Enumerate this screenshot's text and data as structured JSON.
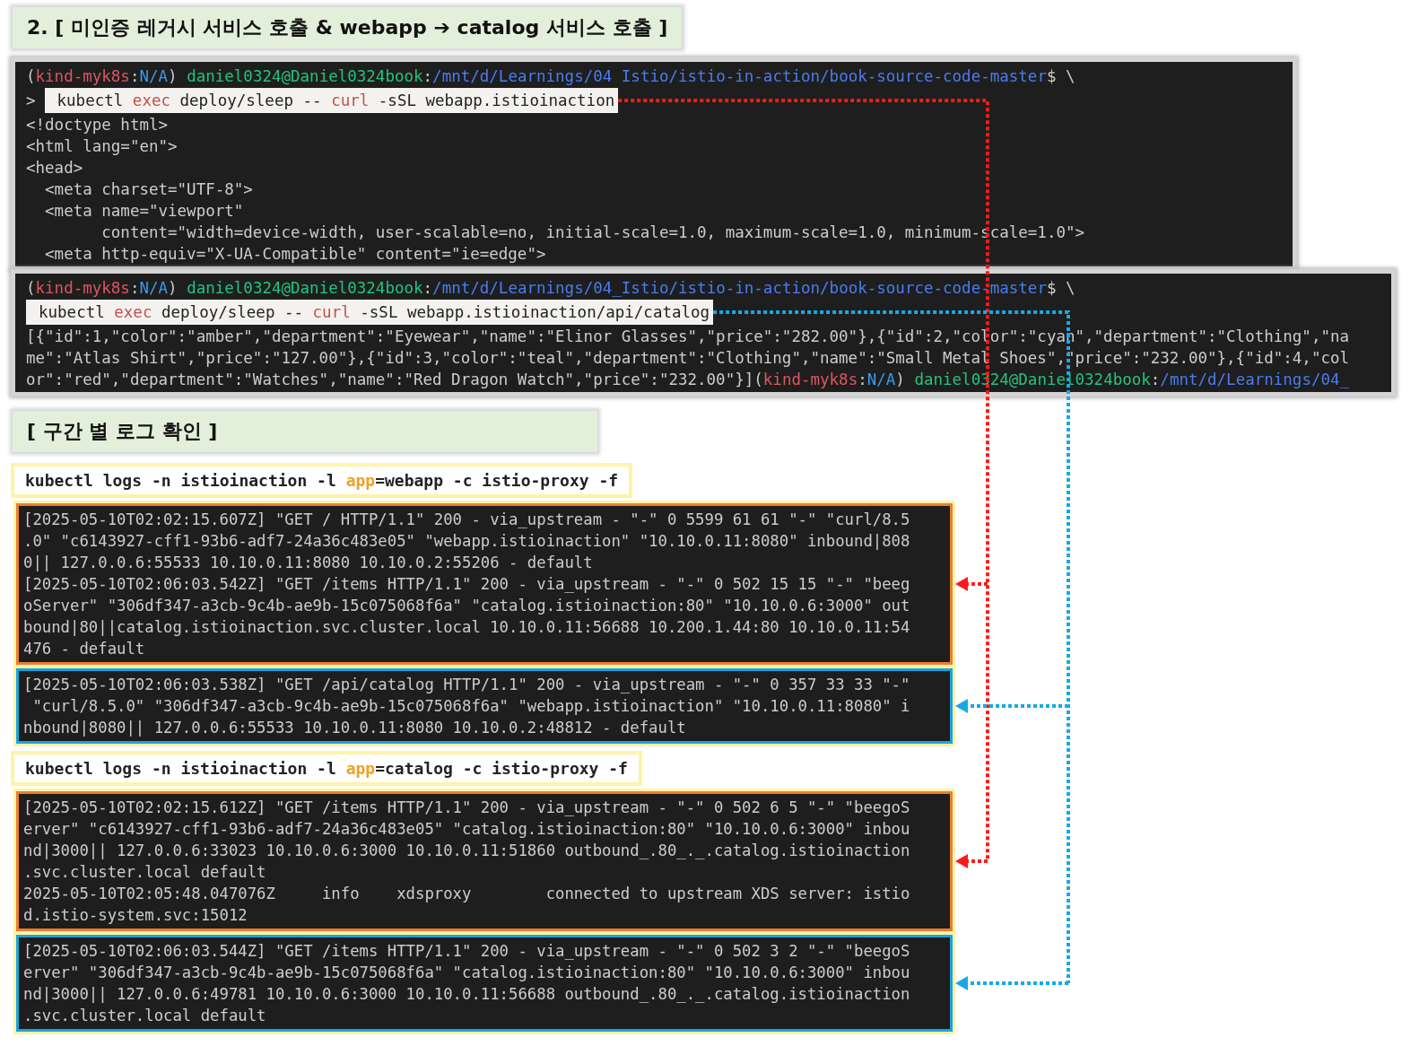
{
  "title": "2. [ 미인증 레거시 서비스 호출 & webapp ➔ catalog 서비스 호출 ]",
  "terminals": [
    {
      "prompt": [
        {
          "text": "(",
          "color": "#cccccc"
        },
        {
          "text": "kind-myk8s",
          "color": "#e05561"
        },
        {
          "text": ":",
          "color": "#cccccc"
        },
        {
          "text": "N/A",
          "color": "#3b9ae8"
        },
        {
          "text": ")",
          "color": "#cccccc"
        },
        {
          "text": " daniel0324@Daniel0324book",
          "color": "#23c47e"
        },
        {
          "text": ":",
          "color": "#cccccc"
        },
        {
          "text": "/mnt/d/Learnings/04 Istio/istio-in-action/book-source-code-master",
          "color": "#4a7cf0"
        },
        {
          "text": "$ \\",
          "color": "#cccccc"
        }
      ],
      "caret": ">",
      "command": [
        {
          "text": "kubectl ",
          "color": "#222222"
        },
        {
          "text": "exec",
          "color": "#c0504d"
        },
        {
          "text": " deploy/sleep -- ",
          "color": "#222222"
        },
        {
          "text": "curl",
          "color": "#c0504d"
        },
        {
          "text": " -sSL webapp.istioinaction",
          "color": "#222222"
        }
      ],
      "output": [
        [
          {
            "text": "<!doctype html>"
          }
        ],
        [
          {
            "text": "<html lang=\"en\">"
          }
        ],
        [
          {
            "text": "<head>"
          }
        ],
        [
          {
            "text": "  <meta charset=\"UTF-8\">"
          }
        ],
        [
          {
            "text": "  <meta name=\"viewport\""
          }
        ],
        [
          {
            "text": "        content=\"width=device-width, user-scalable=no, initial-scale=1.0, maximum-scale=1.0, minimum-scale=1.0\">"
          }
        ],
        [
          {
            "text": "  <meta http-equiv=\"X-UA-Compatible\" content=\"ie=edge\">"
          }
        ]
      ]
    },
    {
      "prompt": [
        {
          "text": "(",
          "color": "#cccccc"
        },
        {
          "text": "kind-myk8s",
          "color": "#e05561"
        },
        {
          "text": ":",
          "color": "#cccccc"
        },
        {
          "text": "N/A",
          "color": "#3b9ae8"
        },
        {
          "text": ")",
          "color": "#cccccc"
        },
        {
          "text": " daniel0324@Daniel0324book",
          "color": "#23c47e"
        },
        {
          "text": ":",
          "color": "#cccccc"
        },
        {
          "text": "/mnt/d/Learnings/04_Istio/istio-in-action/book-source-code-master",
          "color": "#4a7cf0"
        },
        {
          "text": "$ \\",
          "color": "#cccccc"
        }
      ],
      "command": [
        {
          "text": "kubectl ",
          "color": "#222222"
        },
        {
          "text": "exec",
          "color": "#c0504d"
        },
        {
          "text": " deploy/sleep -- ",
          "color": "#222222"
        },
        {
          "text": "curl",
          "color": "#c0504d"
        },
        {
          "text": " -sSL webapp.istioinaction/api/catalog",
          "color": "#222222"
        }
      ],
      "output": [
        [
          {
            "text": "[{\"id\":1,\"color\":\"amber\",\"department\":\"Eyewear\",\"name\":\"Elinor Glasses\",\"price\":\"282.00\"},{\"id\":2,\"color\":\"cyan\",\"department\":\"Clothing\",\"na"
          }
        ],
        [
          {
            "text": "me\":\"Atlas Shirt\",\"price\":\"127.00\"},{\"id\":3,\"color\":\"teal\",\"department\":\"Clothing\",\"name\":\"Small Metal Shoes\",\"price\":\"232.00\"},{\"id\":4,\"col"
          }
        ],
        [
          {
            "text": "or\":\"red\",\"department\":\"Watches\",\"name\":\"Red Dragon Watch\",\"price\":\"232.00\"}]"
          },
          {
            "text": "(",
            "color": "#cccccc"
          },
          {
            "text": "kind-myk8s",
            "color": "#e05561"
          },
          {
            "text": ":",
            "color": "#cccccc"
          },
          {
            "text": "N/A",
            "color": "#3b9ae8"
          },
          {
            "text": ")",
            "color": "#cccccc"
          },
          {
            "text": " daniel0324@Daniel0324book",
            "color": "#23c47e"
          },
          {
            "text": ":",
            "color": "#cccccc"
          },
          {
            "text": "/mnt/d/Learnings/04_",
            "color": "#4a7cf0"
          }
        ]
      ]
    }
  ],
  "section_title": "[ 구간 별 로그 확인 ]",
  "log_sections": [
    {
      "command": [
        {
          "text": "kubectl logs -n istioinaction -l ",
          "color": "#222222"
        },
        {
          "text": "app",
          "color": "#f0a020"
        },
        {
          "text": "=webapp -c istio-proxy -f",
          "color": "#222222"
        }
      ],
      "boxes": [
        {
          "color": "#ed7d31",
          "lines": [
            "[2025-05-10T02:02:15.607Z] \"GET / HTTP/1.1\" 200 - via_upstream - \"-\" 0 5599 61 61 \"-\" \"curl/8.5",
            ".0\" \"c6143927-cff1-93b6-adf7-24a36c483e05\" \"webapp.istioinaction\" \"10.10.0.11:8080\" inbound|808",
            "0|| 127.0.0.6:55533 10.10.0.11:8080 10.10.0.2:55206 - default",
            "[2025-05-10T02:06:03.542Z] \"GET /items HTTP/1.1\" 200 - via_upstream - \"-\" 0 502 15 15 \"-\" \"beeg",
            "oServer\" \"306df347-a3cb-9c4b-ae9b-15c075068f6a\" \"catalog.istioinaction:80\" \"10.10.0.6:3000\" out",
            "bound|80||catalog.istioinaction.svc.cluster.local 10.10.0.11:56688 10.200.1.44:80 10.10.0.11:54",
            "476 - default"
          ]
        },
        {
          "color": "#1aa3e0",
          "lines": [
            "[2025-05-10T02:06:03.538Z] \"GET /api/catalog HTTP/1.1\" 200 - via_upstream - \"-\" 0 357 33 33 \"-\"",
            " \"curl/8.5.0\" \"306df347-a3cb-9c4b-ae9b-15c075068f6a\" \"webapp.istioinaction\" \"10.10.0.11:8080\" i",
            "nbound|8080|| 127.0.0.6:55533 10.10.0.11:8080 10.10.0.2:48812 - default"
          ]
        }
      ]
    },
    {
      "command": [
        {
          "text": "kubectl logs -n istioinaction -l ",
          "color": "#222222"
        },
        {
          "text": "app",
          "color": "#f0a020"
        },
        {
          "text": "=catalog -c istio-proxy -f",
          "color": "#222222"
        }
      ],
      "boxes": [
        {
          "color": "#ed7d31",
          "lines": [
            "[2025-05-10T02:02:15.612Z] \"GET /items HTTP/1.1\" 200 - via_upstream - \"-\" 0 502 6 5 \"-\" \"beegoS",
            "erver\" \"c6143927-cff1-93b6-adf7-24a36c483e05\" \"catalog.istioinaction:80\" \"10.10.0.6:3000\" inbou",
            "nd|3000|| 127.0.0.6:33023 10.10.0.6:3000 10.10.0.11:51860 outbound_.80_._.catalog.istioinaction",
            ".svc.cluster.local default",
            "2025-05-10T02:05:48.047076Z     info    xdsproxy        connected to upstream XDS server: istio",
            "d.istio-system.svc:15012"
          ]
        },
        {
          "color": "#1aa3e0",
          "lines": [
            "[2025-05-10T02:06:03.544Z] \"GET /items HTTP/1.1\" 200 - via_upstream - \"-\" 0 502 3 2 \"-\" \"beegoS",
            "erver\" \"306df347-a3cb-9c4b-ae9b-15c075068f6a\" \"catalog.istioinaction:80\" \"10.10.0.6:3000\" inbou",
            "nd|3000|| 127.0.0.6:49781 10.10.0.6:3000 10.10.0.11:56688 outbound_.80_._.catalog.istioinaction",
            ".svc.cluster.local default"
          ]
        }
      ]
    }
  ]
}
